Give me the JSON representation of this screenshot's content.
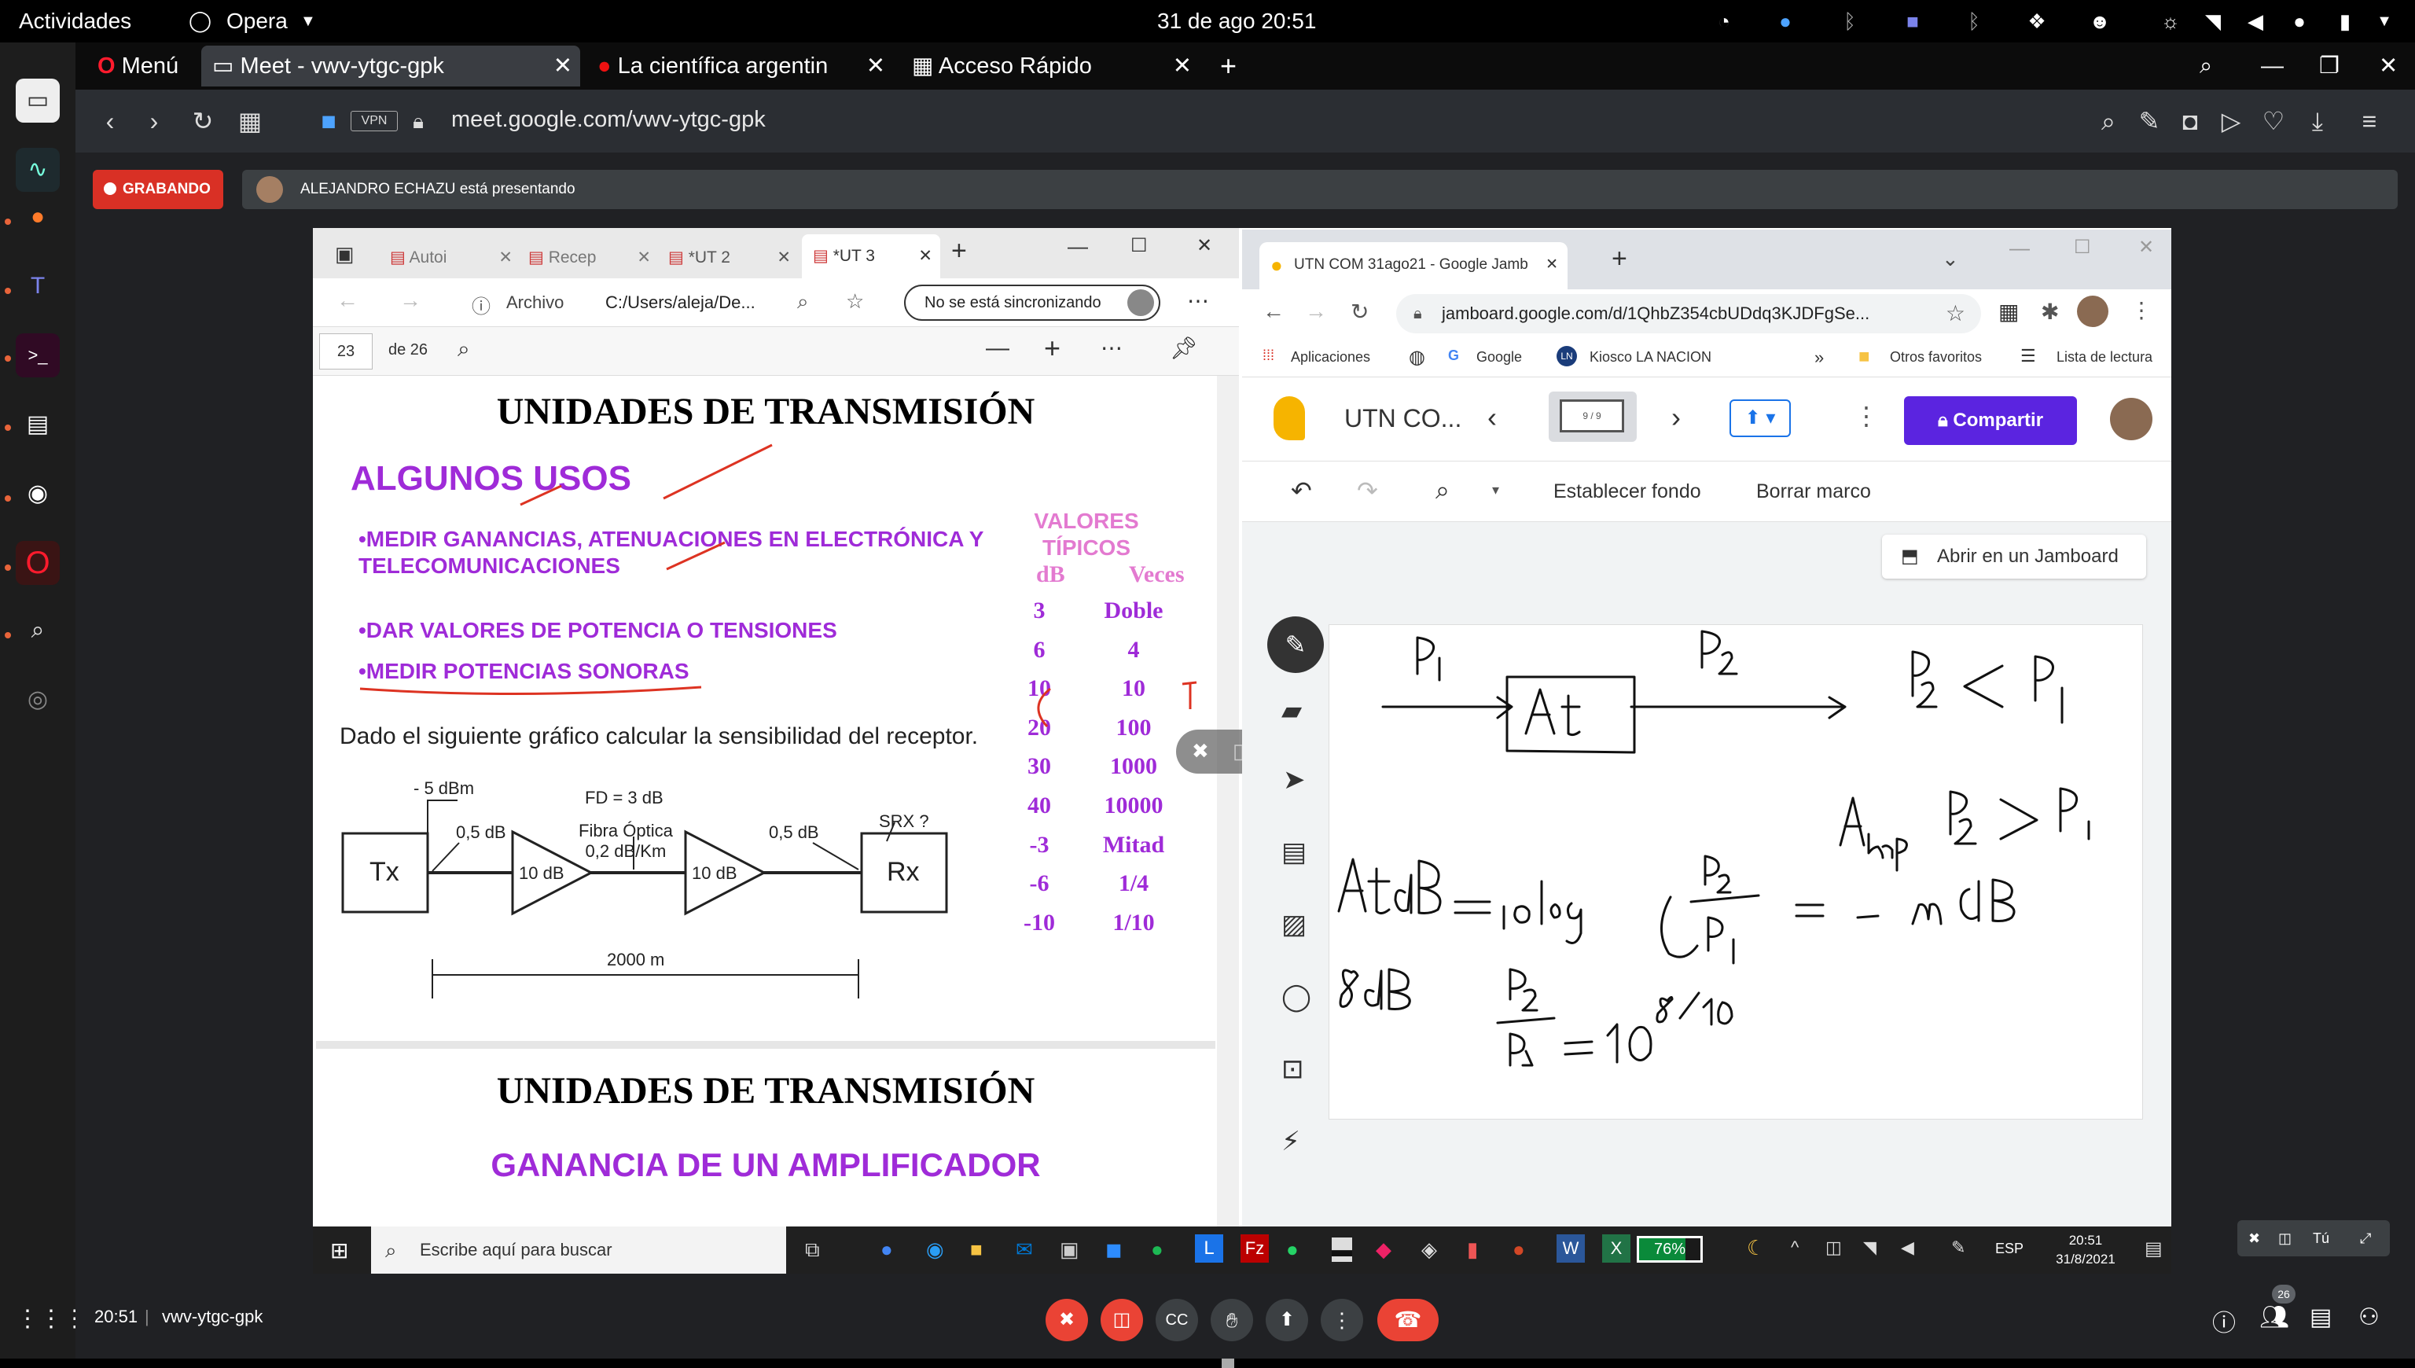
{
  "topbar": {
    "activities": "Actividades",
    "app_name": "Opera",
    "clock": "31 de ago  20:51"
  },
  "opera": {
    "menu_label": "Menú",
    "tabs": [
      {
        "label": "Meet - vwv-ytgc-gpk"
      },
      {
        "label": "La científica argentin"
      },
      {
        "label": "Acceso Rápido"
      }
    ],
    "url": "meet.google.com/vwv-ytgc-gpk",
    "vpn": "VPN"
  },
  "meet": {
    "recording": "GRABANDO",
    "presenting": "ALEJANDRO ECHAZU está presentando",
    "time": "20:51",
    "separator": "|",
    "meeting_code": "vwv-ytgc-gpk",
    "participants_count": "26"
  },
  "edge": {
    "tabs": [
      "Autoi",
      "Recep",
      "*UT 2",
      "*UT 3"
    ],
    "file_label": "Archivo",
    "path": "C:/Users/aleja/De...",
    "sync": "No se está sincronizando",
    "page": "23",
    "of_pages": "de 26"
  },
  "pdf": {
    "title1": "UNIDADES DE TRANSMISIÓN",
    "heading": "ALGUNOS USOS",
    "bullet1a": "•MEDIR GANANCIAS, ATENUACIONES EN ELECTRÓNICA Y",
    "bullet1b": "TELECOMUNICACIONES",
    "bullet2": "•DAR VALORES DE POTENCIA O TENSIONES",
    "bullet3": "•MEDIR POTENCIAS SONORAS",
    "valores1": "VALORES",
    "valores2": "TÍPICOS",
    "col_db": "dB",
    "col_veces": "Veces",
    "table": [
      [
        "3",
        "Doble"
      ],
      [
        "6",
        "4"
      ],
      [
        "10",
        "10"
      ],
      [
        "20",
        "100"
      ],
      [
        "30",
        "1000"
      ],
      [
        "40",
        "10000"
      ],
      [
        "-3",
        "Mitad"
      ],
      [
        "-6",
        "1/4"
      ],
      [
        "-10",
        "1/10"
      ]
    ],
    "problem": "Dado el siguiente gráfico calcular la sensibilidad del receptor.",
    "diag_tx": "Tx",
    "diag_rx": "Rx",
    "diag_m5": "- 5 dBm",
    "diag_fd": "FD = 3 dB",
    "diag_fibra1": "Fibra Óptica",
    "diag_fibra2": "0,2 dB/Km",
    "diag_05a": "0,5 dB",
    "diag_05b": "0,5 dB",
    "diag_srx": "SRX ?",
    "diag_amp1": "10 dB",
    "diag_amp2": "10 dB",
    "diag_dist": "2000 m",
    "title2": "UNIDADES DE TRANSMISIÓN",
    "heading2": "GANANCIA DE UN AMPLIFICADOR"
  },
  "chrome": {
    "tab": "UTN COM 31ago21 - Google Jamb",
    "url": "jamboard.google.com/d/1QhbZ354cbUDdq3KJDFgSe...",
    "bm_apps": "Aplicaciones",
    "bm_google": "Google",
    "bm_kiosco": "Kiosco LA NACION",
    "bm_more": "»",
    "bm_otros": "Otros favoritos",
    "bm_lectura": "Lista de lectura"
  },
  "jamboard": {
    "title": "UTN CO...",
    "frame": "9 / 9",
    "share": "Compartir",
    "set_bg": "Establecer fondo",
    "clear": "Borrar marco",
    "open_in": "Abrir en un Jamboard"
  },
  "win_taskbar": {
    "search": "Escribe aquí para buscar",
    "battery": "76%",
    "lang": "ESP",
    "time": "20:51",
    "date": "31/8/2021"
  },
  "self_tile": {
    "label": "Tú"
  },
  "colors": {
    "meet_bg": "#202124",
    "rec_red": "#d93025",
    "purple": "#9f2bd8",
    "pink": "#e37ad0",
    "share_purple": "#5b24e0"
  }
}
